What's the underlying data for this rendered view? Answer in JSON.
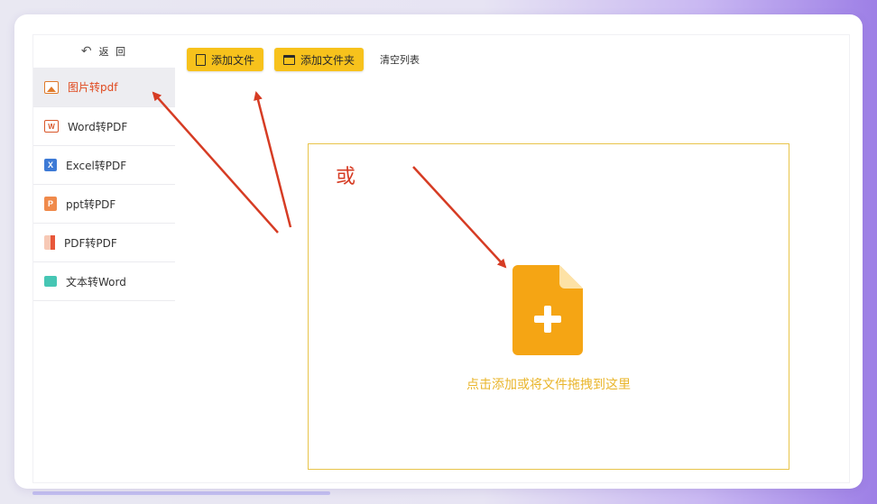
{
  "sidebar": {
    "back_label": "返 回",
    "items": [
      {
        "label": "图片转pdf",
        "icon": "image-icon",
        "active": true
      },
      {
        "label": "Word转PDF",
        "icon": "word-icon"
      },
      {
        "label": "Excel转PDF",
        "icon": "excel-icon"
      },
      {
        "label": "ppt转PDF",
        "icon": "ppt-icon"
      },
      {
        "label": "PDF转PDF",
        "icon": "pdf-icon"
      },
      {
        "label": "文本转Word",
        "icon": "text-icon"
      }
    ]
  },
  "toolbar": {
    "add_file_label": "添加文件",
    "add_folder_label": "添加文件夹",
    "clear_list_label": "清空列表"
  },
  "drop_zone": {
    "or_label": "或",
    "hint": "点击添加或将文件拖拽到这里"
  },
  "colors": {
    "accent_yellow": "#f7c21c",
    "file_icon_orange": "#f5a514",
    "annotation_red": "#d63c24",
    "active_text": "#e04a1f"
  }
}
